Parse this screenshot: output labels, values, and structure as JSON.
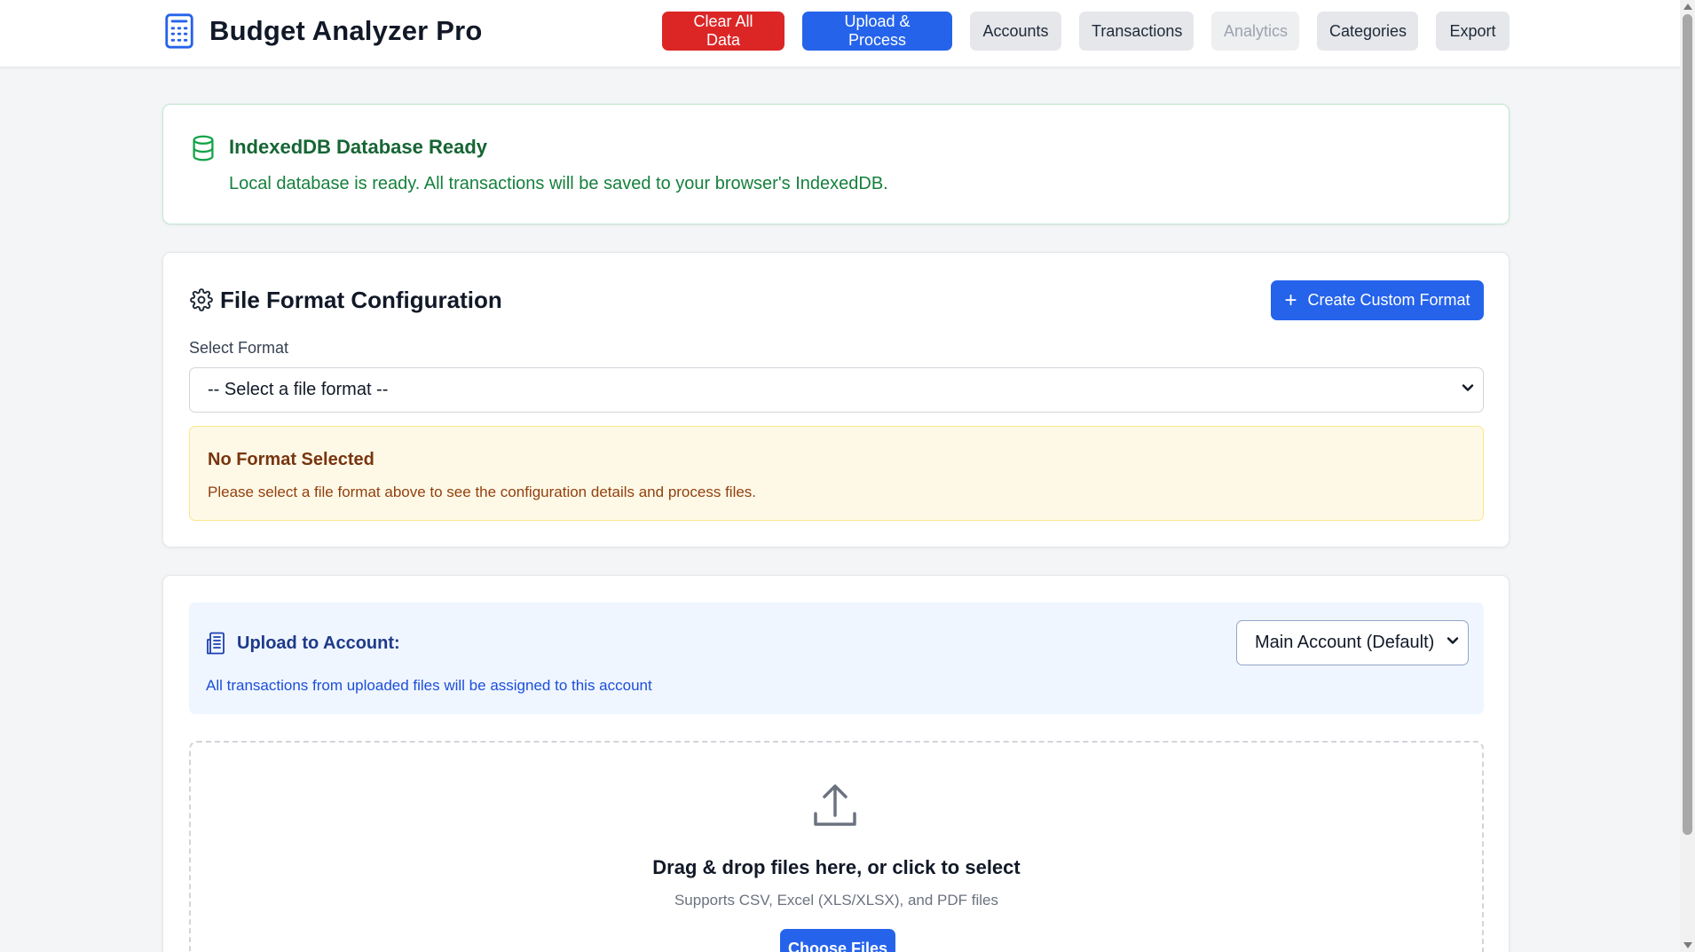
{
  "app": {
    "title": "Budget Analyzer Pro",
    "brand_icon": "calculator-icon"
  },
  "nav": {
    "clear_all": "Clear All Data",
    "upload_process": "Upload & Process",
    "accounts": "Accounts",
    "transactions": "Transactions",
    "analytics": "Analytics",
    "categories": "Categories",
    "export": "Export"
  },
  "db_status": {
    "icon": "database-icon",
    "title": "IndexedDB Database Ready",
    "message": "Local database is ready. All transactions will be saved to your browser's IndexedDB."
  },
  "file_format": {
    "icon": "gear-icon",
    "title": "File Format Configuration",
    "create_button": "Create Custom Format",
    "select_label": "Select Format",
    "select_value": "-- Select a file format --",
    "warning_title": "No Format Selected",
    "warning_text": "Please select a file format above to see the configuration details and process files."
  },
  "upload": {
    "account_icon": "building-icon",
    "account_label": "Upload to Account:",
    "account_desc": "All transactions from uploaded files will be assigned to this account",
    "account_value": "Main Account (Default)",
    "drop_icon": "upload-icon",
    "drop_title": "Drag & drop files here, or click to select",
    "drop_sub": "Supports CSV, Excel (XLS/XLSX), and PDF files",
    "choose_button": "Choose Files"
  },
  "colors": {
    "primary": "#2563eb",
    "danger": "#dc2626",
    "success": "#166534",
    "warning_bg": "#fef9e7",
    "info_bg": "#eff6ff"
  }
}
